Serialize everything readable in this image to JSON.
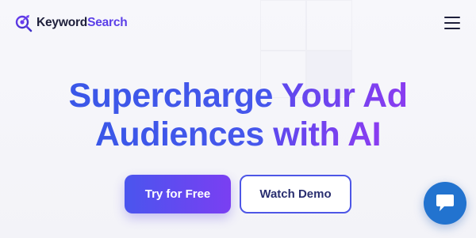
{
  "header": {
    "logo_part1": "Keyword",
    "logo_part2": "Search",
    "logo_icon": "magnifier-target-icon",
    "menu_icon": "hamburger-menu-icon"
  },
  "hero": {
    "title_line1_blue": "Supercharge ",
    "title_line1_purple": "Your Ad",
    "title_line2_blue": "Audiences ",
    "title_line2_purple": "with AI"
  },
  "actions": {
    "primary_label": "Try for Free",
    "secondary_label": "Watch Demo"
  },
  "chat": {
    "icon": "chat-bubble-icon"
  },
  "colors": {
    "brand_purple": "#5b3fe8",
    "title_blue": "#3a57e8",
    "title_purple": "#8a3cf0",
    "chat_blue": "#2273cf"
  }
}
